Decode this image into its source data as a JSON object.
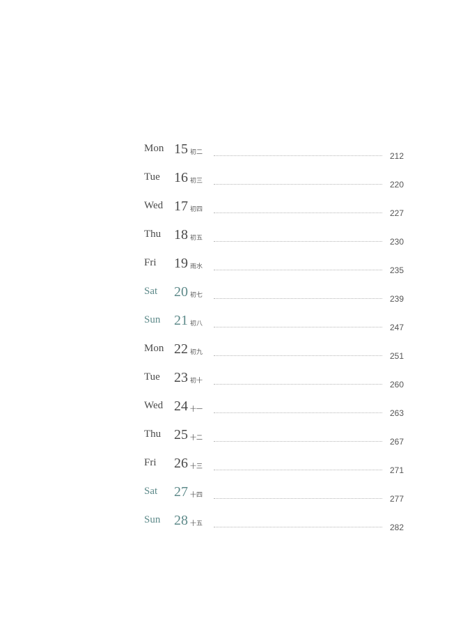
{
  "entries": [
    {
      "dow": "Mon",
      "day": "15",
      "lunar": "初二",
      "page": "212",
      "weekend": false
    },
    {
      "dow": "Tue",
      "day": "16",
      "lunar": "初三",
      "page": "220",
      "weekend": false
    },
    {
      "dow": "Wed",
      "day": "17",
      "lunar": "初四",
      "page": "227",
      "weekend": false
    },
    {
      "dow": "Thu",
      "day": "18",
      "lunar": "初五",
      "page": "230",
      "weekend": false
    },
    {
      "dow": "Fri",
      "day": "19",
      "lunar": "雨水",
      "page": "235",
      "weekend": false
    },
    {
      "dow": "Sat",
      "day": "20",
      "lunar": "初七",
      "page": "239",
      "weekend": true
    },
    {
      "dow": "Sun",
      "day": "21",
      "lunar": "初八",
      "page": "247",
      "weekend": true
    },
    {
      "dow": "Mon",
      "day": "22",
      "lunar": "初九",
      "page": "251",
      "weekend": false
    },
    {
      "dow": "Tue",
      "day": "23",
      "lunar": "初十",
      "page": "260",
      "weekend": false
    },
    {
      "dow": "Wed",
      "day": "24",
      "lunar": "十一",
      "page": "263",
      "weekend": false
    },
    {
      "dow": "Thu",
      "day": "25",
      "lunar": "十二",
      "page": "267",
      "weekend": false
    },
    {
      "dow": "Fri",
      "day": "26",
      "lunar": "十三",
      "page": "271",
      "weekend": false
    },
    {
      "dow": "Sat",
      "day": "27",
      "lunar": "十四",
      "page": "277",
      "weekend": true
    },
    {
      "dow": "Sun",
      "day": "28",
      "lunar": "十五",
      "page": "282",
      "weekend": true
    }
  ],
  "colors": {
    "weekend": "#5e8a8a",
    "weekday": "#4a4a4a"
  }
}
